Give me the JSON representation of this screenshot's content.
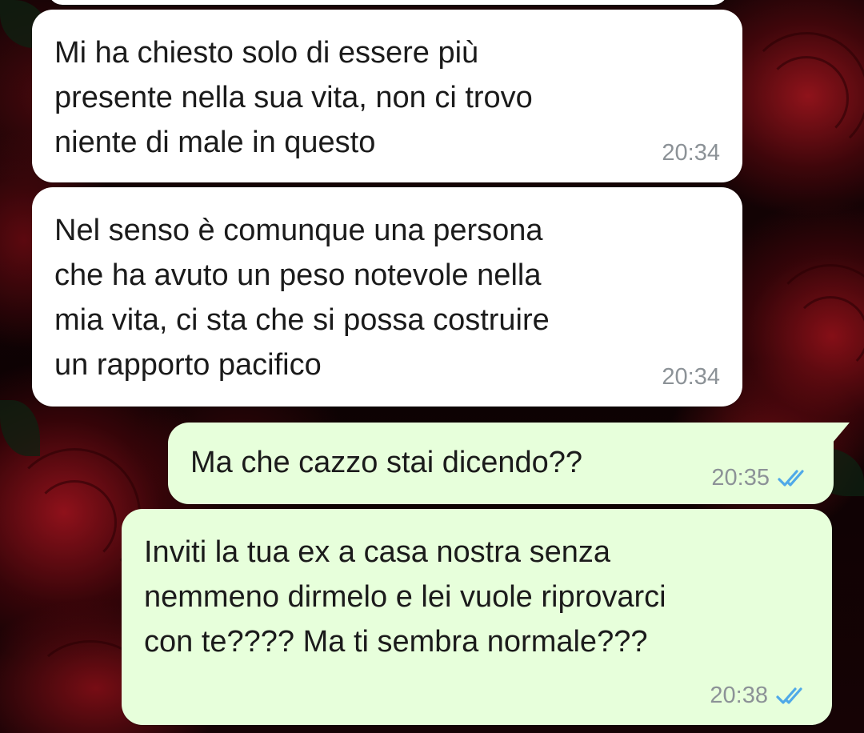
{
  "chat": {
    "messages": [
      {
        "direction": "incoming",
        "text": "Mi ha chiesto solo di essere più\npresente nella sua vita, non ci trovo\nniente di male in questo",
        "time": "20:34"
      },
      {
        "direction": "incoming",
        "text": "Nel senso è comunque una persona\nche ha avuto un peso notevole nella\nmia vita, ci sta che si possa costruire\nun rapporto pacifico",
        "time": "20:34"
      },
      {
        "direction": "outgoing",
        "text": "Ma che cazzo stai dicendo??",
        "time": "20:35",
        "status_icon": "double-check-read-icon"
      },
      {
        "direction": "outgoing",
        "text": "Inviti la tua ex a casa nostra senza\nnemmeno dirmelo e lei vuole riprovarci\ncon te???? Ma ti sembra normale???",
        "time": "20:38",
        "status_icon": "double-check-read-icon"
      }
    ]
  },
  "colors": {
    "incoming_bubble": "#ffffff",
    "outgoing_bubble": "#e7ffdb",
    "read_tick": "#4fa9e8",
    "timestamp": "#8c9297"
  }
}
